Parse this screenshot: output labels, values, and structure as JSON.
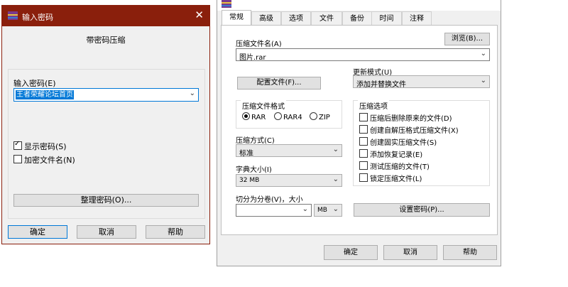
{
  "password_dialog": {
    "title": "输入密码",
    "heading": "带密码压缩",
    "password_label": "输入密码(E)",
    "password_value": "王者荣耀论坛首页",
    "show_password_label": "显示密码(S)",
    "show_password_checked": true,
    "encrypt_names_label": "加密文件名(N)",
    "encrypt_names_checked": false,
    "organize_button": "整理密码(O)...",
    "ok": "确定",
    "cancel": "取消",
    "help": "帮助"
  },
  "archive_dialog": {
    "tabs": [
      "常规",
      "高级",
      "选项",
      "文件",
      "备份",
      "时间",
      "注释"
    ],
    "active_tab": "常规",
    "archive_name_label": "压缩文件名(A)",
    "browse_button": "浏览(B)...",
    "archive_name_value": "图片.rar",
    "update_mode_label": "更新模式(U)",
    "update_mode_value": "添加并替换文件",
    "profiles_button": "配置文件(F)...",
    "format_group_label": "压缩文件格式",
    "formats": [
      "RAR",
      "RAR4",
      "ZIP"
    ],
    "selected_format": "RAR",
    "options_group_label": "压缩选项",
    "options": [
      {
        "label": "压缩后删除原来的文件(D)",
        "checked": false
      },
      {
        "label": "创建自解压格式压缩文件(X)",
        "checked": false
      },
      {
        "label": "创建固实压缩文件(S)",
        "checked": false
      },
      {
        "label": "添加恢复记录(E)",
        "checked": false
      },
      {
        "label": "测试压缩的文件(T)",
        "checked": false
      },
      {
        "label": "锁定压缩文件(L)",
        "checked": false
      }
    ],
    "method_label": "压缩方式(C)",
    "method_value": "标准",
    "dict_label": "字典大小(I)",
    "dict_value": "32 MB",
    "split_label": "切分为分卷(V)，大小",
    "split_value": "",
    "split_unit": "MB",
    "set_password_button": "设置密码(P)...",
    "ok": "确定",
    "cancel": "取消",
    "help": "帮助"
  }
}
